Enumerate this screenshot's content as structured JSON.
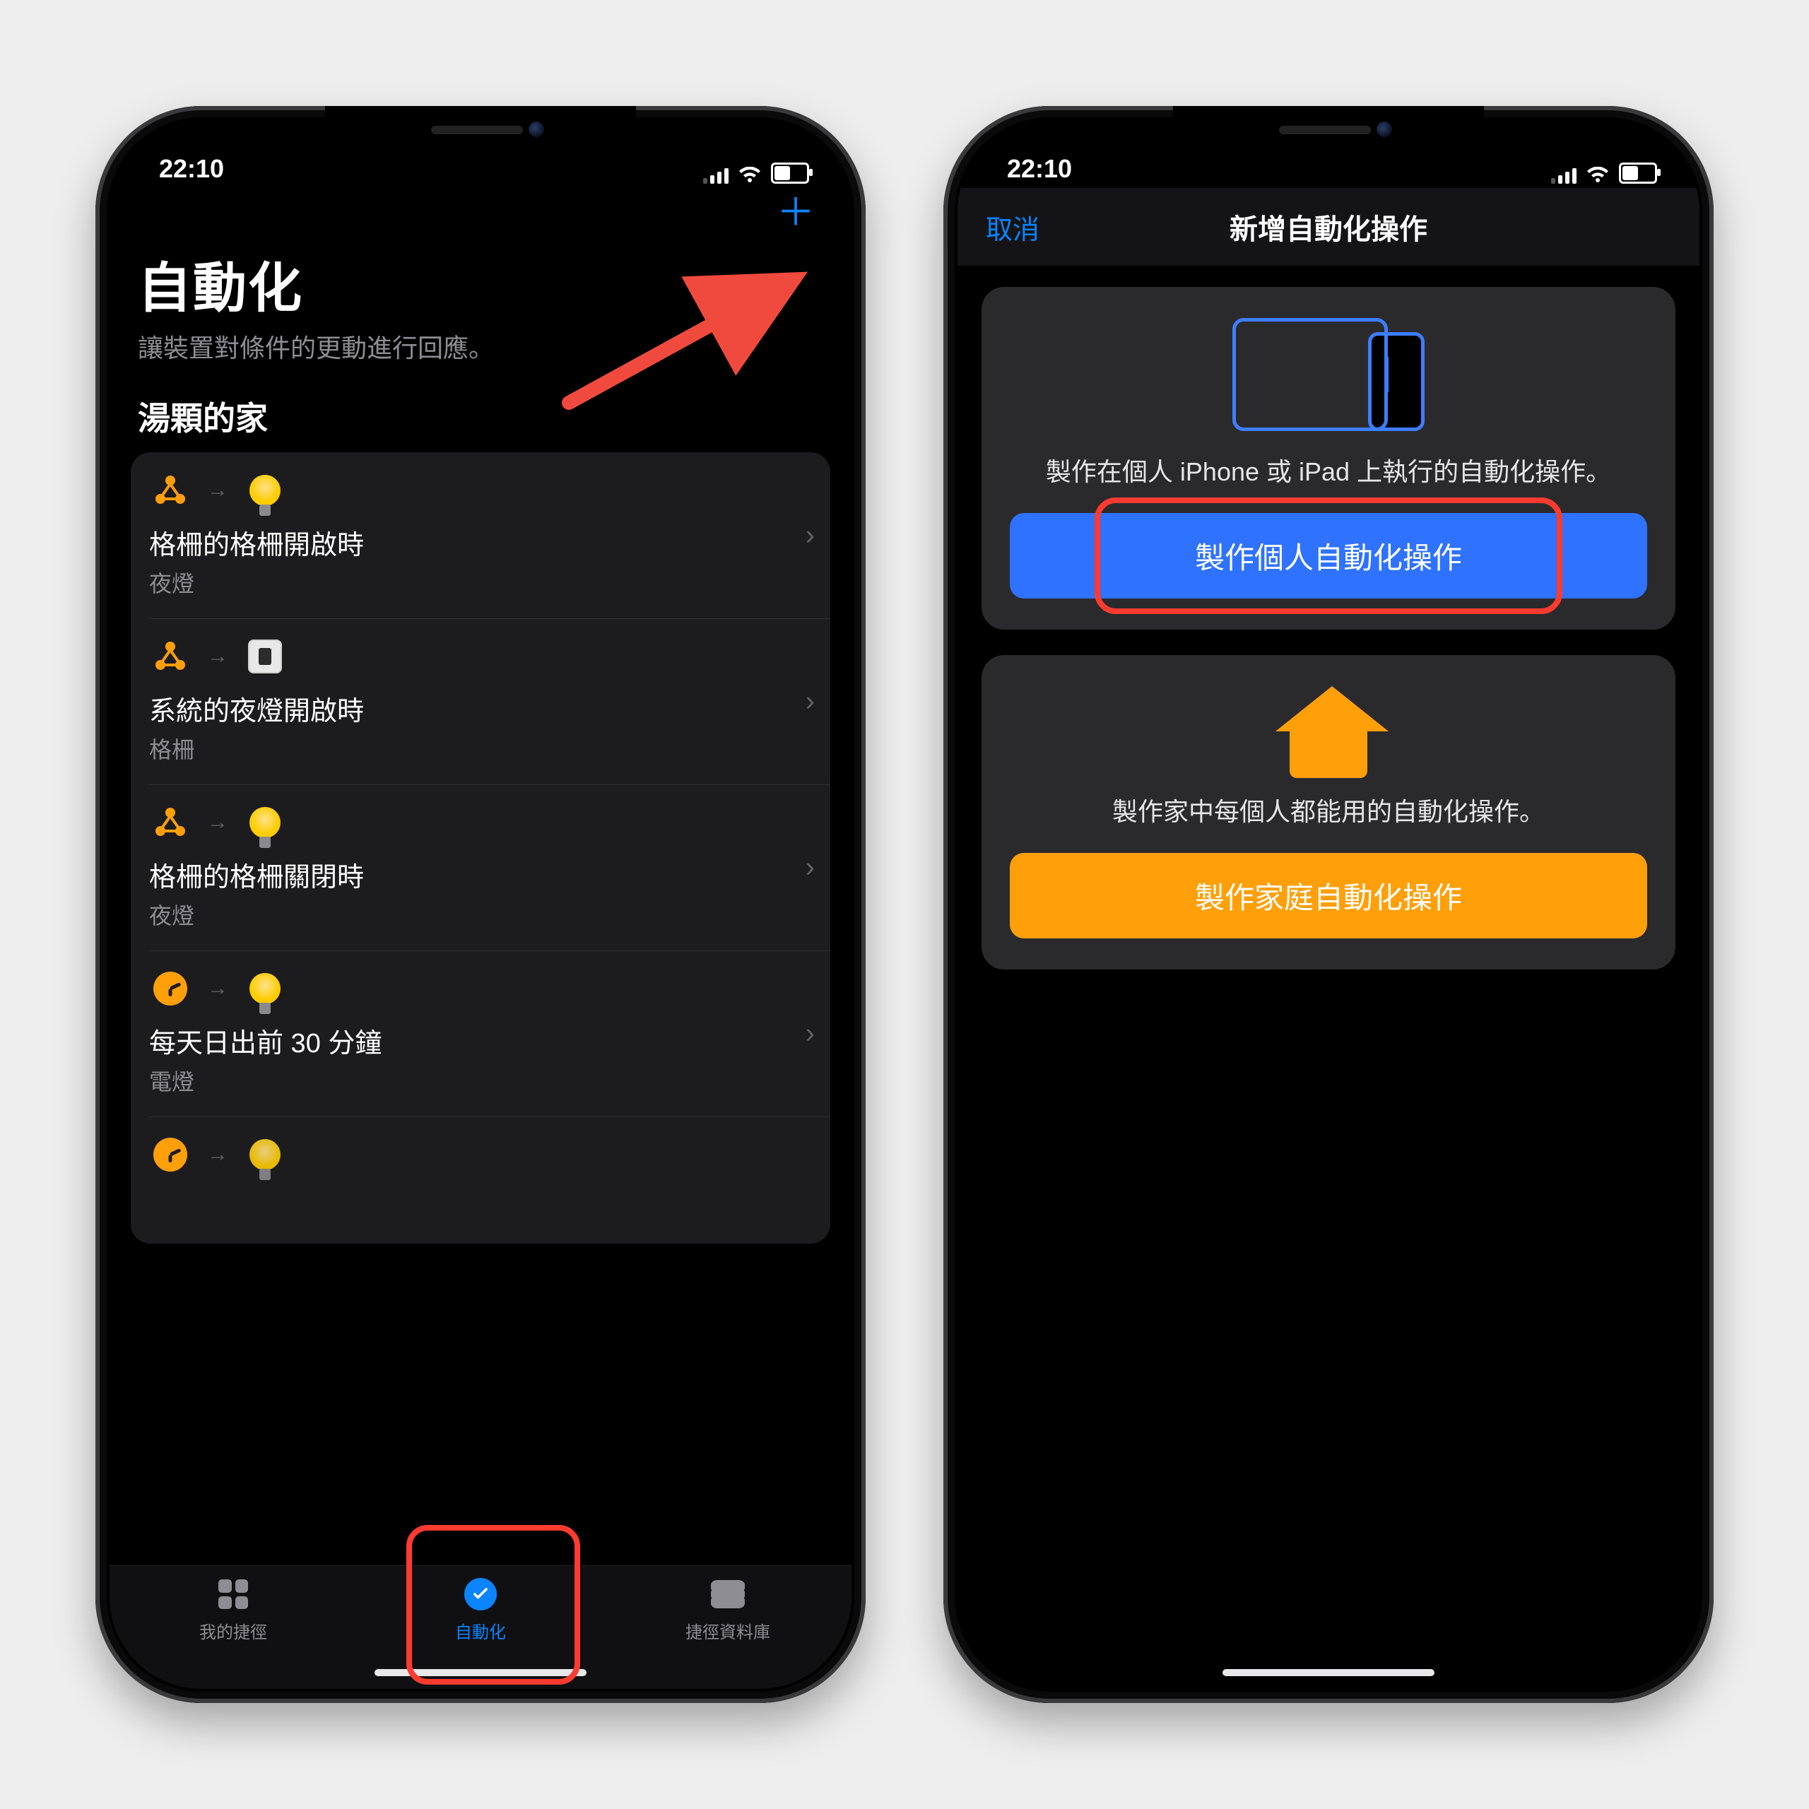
{
  "statusbar": {
    "time": "22:10"
  },
  "left": {
    "nav": {
      "add": "＋"
    },
    "title": "自動化",
    "subtitle": "讓裝置對條件的更動進行回應。",
    "section_title": "湯顆的家",
    "rows": [
      {
        "trigger_icon": "scene",
        "action_icon": "bulb",
        "title": "格柵的格柵開啟時",
        "sub": "夜燈"
      },
      {
        "trigger_icon": "scene",
        "action_icon": "switch",
        "title": "系統的夜燈開啟時",
        "sub": "格柵"
      },
      {
        "trigger_icon": "scene",
        "action_icon": "bulb",
        "title": "格柵的格柵關閉時",
        "sub": "夜燈"
      },
      {
        "trigger_icon": "clock",
        "action_icon": "bulb",
        "title": "每天日出前 30 分鐘",
        "sub": "電燈"
      },
      {
        "trigger_icon": "clock",
        "action_icon": "bulb",
        "title": "",
        "sub": ""
      }
    ],
    "tabs": {
      "shortcuts": "我的捷徑",
      "automation": "自動化",
      "gallery": "捷徑資料庫"
    }
  },
  "right": {
    "header": {
      "cancel": "取消",
      "title": "新增自動化操作"
    },
    "personal": {
      "desc": "製作在個人 iPhone 或 iPad 上執行的自動化操作。",
      "button": "製作個人自動化操作"
    },
    "home": {
      "desc": "製作家中每個人都能用的自動化操作。",
      "button": "製作家庭自動化操作"
    }
  }
}
